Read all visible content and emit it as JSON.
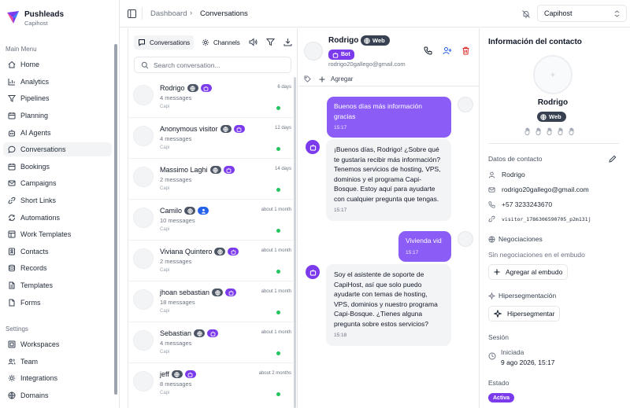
{
  "brand": {
    "name": "Pushleads",
    "subtitle": "Capihost"
  },
  "sidebar": {
    "main_label": "Main Menu",
    "settings_label": "Settings",
    "items": [
      {
        "label": "Home",
        "icon": "home-icon"
      },
      {
        "label": "Analytics",
        "icon": "analytics-icon"
      },
      {
        "label": "Pipelines",
        "icon": "funnel-icon"
      },
      {
        "label": "Planning",
        "icon": "calendar-icon"
      },
      {
        "label": "AI Agents",
        "icon": "bot-icon"
      },
      {
        "label": "Conversations",
        "icon": "chat-icon"
      },
      {
        "label": "Bookings",
        "icon": "calendar-icon"
      },
      {
        "label": "Campaigns",
        "icon": "mail-icon"
      },
      {
        "label": "Short Links",
        "icon": "link-icon"
      },
      {
        "label": "Automations",
        "icon": "automation-icon"
      },
      {
        "label": "Work Templates",
        "icon": "template-icon"
      },
      {
        "label": "Contacts",
        "icon": "contacts-icon"
      },
      {
        "label": "Records",
        "icon": "records-icon"
      },
      {
        "label": "Templates",
        "icon": "document-icon"
      },
      {
        "label": "Forms",
        "icon": "form-icon"
      }
    ],
    "settings_items": [
      {
        "label": "Workspaces",
        "icon": "workspaces-icon"
      },
      {
        "label": "Team",
        "icon": "team-icon"
      },
      {
        "label": "Integrations",
        "icon": "integrations-icon"
      },
      {
        "label": "Domains",
        "icon": "globe-icon"
      }
    ]
  },
  "topbar": {
    "breadcrumb": {
      "parent": "Dashboard",
      "separator": "›",
      "current": "Conversations"
    },
    "workspace": "Capihost"
  },
  "list": {
    "tab_conversations": "Conversations",
    "tab_channels": "Channels",
    "search_placeholder": "Search conversation...",
    "items": [
      {
        "name": "Rodrigo",
        "messages": "4 messages",
        "source": "Capi",
        "time": "6 days",
        "badge": "bot"
      },
      {
        "name": "Anonymous visitor",
        "messages": "4 messages",
        "source": "Capi",
        "time": "12 days",
        "badge": "bot"
      },
      {
        "name": "Massimo Laghi",
        "messages": "2 messages",
        "source": "Capi",
        "time": "14 days",
        "badge": "bot"
      },
      {
        "name": "Camilo",
        "messages": "10 messages",
        "source": "Capi",
        "time": "about 1 month",
        "badge": "user"
      },
      {
        "name": "Viviana Quintero",
        "messages": "2 messages",
        "source": "Capi",
        "time": "about 1 month",
        "badge": "bot"
      },
      {
        "name": "jhoan sebastian",
        "messages": "18 messages",
        "source": "Capi",
        "time": "about 1 month",
        "badge": "bot"
      },
      {
        "name": "Sebastian",
        "messages": "4 messages",
        "source": "Capi",
        "time": "about 1 month",
        "badge": "bot"
      },
      {
        "name": "jeff",
        "messages": "8 messages",
        "source": "Capi",
        "time": "about 2 months",
        "badge": "bot"
      }
    ]
  },
  "chat": {
    "contact_name": "Rodrigo",
    "channel": "Web",
    "bot_label": "Bot",
    "email": "rodrigo20gallego@gmail.com",
    "add_tag": "Agregar",
    "messages": [
      {
        "from": "user",
        "text": "Buenos días más información gracias",
        "time": "15:17"
      },
      {
        "from": "bot",
        "text": "¡Buenos días, Rodrigo! ¿Sobre qué te gustaría recibir más información? Tenemos servicios de hosting, VPS, dominios y el programa Capi-Bosque. Estoy aquí para ayudarte con cualquier pregunta que tengas.",
        "time": "15:17"
      },
      {
        "from": "user",
        "text": "Vivienda vid",
        "time": "15:17"
      },
      {
        "from": "bot",
        "text": "Soy el asistente de soporte de CapiHost, así que solo puedo ayudarte con temas de hosting, VPS, dominios y nuestro programa Capi-Bosque. ¿Tienes alguna pregunta sobre estos servicios?",
        "time": "15:18"
      }
    ]
  },
  "contact": {
    "panel_title": "Información del contacto",
    "name": "Rodrigo",
    "channel": "Web",
    "datos_label": "Datos de contacto",
    "name_value": "Rodrigo",
    "email": "rodrigo20gallego@gmail.com",
    "phone": "+57 3233243670",
    "visitor_id": "visitor_1786306590705_p2m131j",
    "negociaciones_label": "Negociaciones",
    "negociaciones_empty": "Sin negociaciones en el embudo",
    "add_funnel": "Agregar al embudo",
    "hiperseg_label": "Hipersegmentación",
    "hiperseg_button": "Hipersegmentar",
    "session_label": "Sesión",
    "session_started": "Iniciada",
    "session_date": "9 ago 2026, 15:17",
    "status_label": "Estado",
    "status_value": "Activa"
  }
}
